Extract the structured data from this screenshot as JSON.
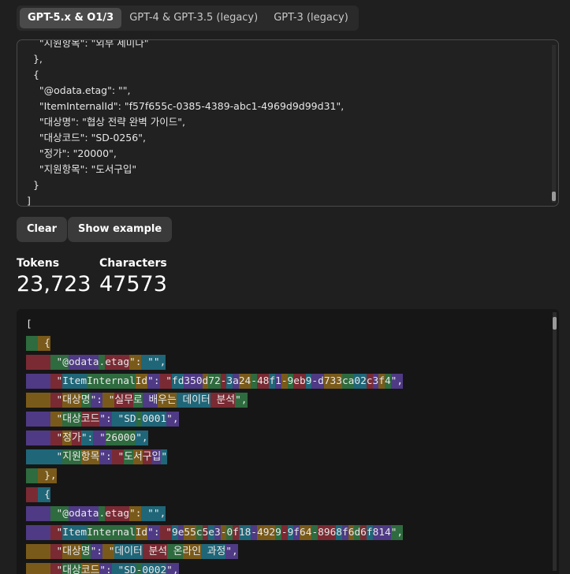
{
  "tabs": [
    {
      "label": "GPT-5.x & O1/3",
      "active": true
    },
    {
      "label": "GPT-4 & GPT-3.5 (legacy)",
      "active": false
    },
    {
      "label": "GPT-3 (legacy)",
      "active": false
    }
  ],
  "input": {
    "lines": [
      "    \"지원항목\": \"외부 세미나\"",
      "  },",
      "  {",
      "    \"@odata.etag\": \"\",",
      "    \"ItemInternalId\": \"f57f655c-0385-4389-abc1-4969d9d99d31\",",
      "    \"대상명\": \"협상 전략 완벽 가이드\",",
      "    \"대상코드\": \"SD-0256\",",
      "    \"정가\": \"20000\",",
      "    \"지원항목\": \"도서구입\"",
      "  }",
      "]"
    ],
    "scroll_fraction": 1.0
  },
  "buttons": {
    "clear": "Clear",
    "example": "Show example"
  },
  "stats": {
    "tokens_label": "Tokens",
    "tokens_value": "23,723",
    "chars_label": "Characters",
    "chars_value": "47573"
  },
  "token_lines": [
    [
      {
        "t": "[",
        "c": -1
      }
    ],
    [
      {
        "t": "  ",
        "c": 1
      },
      {
        "t": " {",
        "c": 2
      }
    ],
    [
      {
        "t": "    ",
        "c": 3
      },
      {
        "t": " \"@",
        "c": 1
      },
      {
        "t": "odata",
        "c": 0
      },
      {
        "t": ".",
        "c": 1
      },
      {
        "t": "etag",
        "c": 3
      },
      {
        "t": "\":",
        "c": 2
      },
      {
        "t": " \"\",",
        "c": 4
      }
    ],
    [
      {
        "t": "    ",
        "c": 0
      },
      {
        "t": " \"",
        "c": 3
      },
      {
        "t": "Item",
        "c": 4
      },
      {
        "t": "Internal",
        "c": 1
      },
      {
        "t": "Id",
        "c": 2
      },
      {
        "t": "\":",
        "c": 0
      },
      {
        "t": " \"",
        "c": 3
      },
      {
        "t": "fd",
        "c": 4
      },
      {
        "t": "350",
        "c": 0
      },
      {
        "t": "d",
        "c": 2
      },
      {
        "t": "72",
        "c": 1
      },
      {
        "t": "-",
        "c": 3
      },
      {
        "t": "3",
        "c": 4
      },
      {
        "t": "a",
        "c": 0
      },
      {
        "t": "24",
        "c": 2
      },
      {
        "t": "-",
        "c": 1
      },
      {
        "t": "48",
        "c": 3
      },
      {
        "t": "f",
        "c": 4
      },
      {
        "t": "1",
        "c": 0
      },
      {
        "t": "-",
        "c": 2
      },
      {
        "t": "9",
        "c": 1
      },
      {
        "t": "eb",
        "c": 3
      },
      {
        "t": "9",
        "c": 4
      },
      {
        "t": "-d",
        "c": 0
      },
      {
        "t": "733",
        "c": 2
      },
      {
        "t": "ca",
        "c": 1
      },
      {
        "t": "02",
        "c": 4
      },
      {
        "t": "c",
        "c": 3
      },
      {
        "t": "3",
        "c": 0
      },
      {
        "t": "f",
        "c": 2
      },
      {
        "t": "4",
        "c": 1
      },
      {
        "t": "\",",
        "c": 0
      }
    ],
    [
      {
        "t": "    ",
        "c": 2
      },
      {
        "t": " \"",
        "c": 3
      },
      {
        "t": "대상",
        "c": 2
      },
      {
        "t": "명",
        "c": 1
      },
      {
        "t": "\":",
        "c": 0
      },
      {
        "t": " \"",
        "c": 2
      },
      {
        "t": "실무",
        "c": 3
      },
      {
        "t": "로",
        "c": 1
      },
      {
        "t": " 배",
        "c": 0
      },
      {
        "t": "우는",
        "c": 2
      },
      {
        "t": " 데이터",
        "c": 4
      },
      {
        "t": " 분석",
        "c": 3
      },
      {
        "t": "\",",
        "c": 1
      }
    ],
    [
      {
        "t": "    ",
        "c": 0
      },
      {
        "t": " \"",
        "c": 2
      },
      {
        "t": "대상",
        "c": 1
      },
      {
        "t": "코드",
        "c": 3
      },
      {
        "t": "\":",
        "c": 0
      },
      {
        "t": " \"",
        "c": 4
      },
      {
        "t": "SD",
        "c": 4
      },
      {
        "t": "-",
        "c": 1
      },
      {
        "t": "0001",
        "c": 4
      },
      {
        "t": "\",",
        "c": 0
      }
    ],
    [
      {
        "t": "    ",
        "c": 0
      },
      {
        "t": " \"",
        "c": 3
      },
      {
        "t": "정",
        "c": 2
      },
      {
        "t": "가",
        "c": 3
      },
      {
        "t": "\":",
        "c": 4
      },
      {
        "t": " \"",
        "c": 0
      },
      {
        "t": "26000",
        "c": 1
      },
      {
        "t": "\",",
        "c": 4
      }
    ],
    [
      {
        "t": "    ",
        "c": 4
      },
      {
        "t": " \"",
        "c": 4
      },
      {
        "t": "지원",
        "c": 1
      },
      {
        "t": "항목",
        "c": 2
      },
      {
        "t": "\":",
        "c": 0
      },
      {
        "t": " \"",
        "c": 3
      },
      {
        "t": "도",
        "c": 1
      },
      {
        "t": "서",
        "c": 2
      },
      {
        "t": "구",
        "c": 3
      },
      {
        "t": "입",
        "c": 0
      },
      {
        "t": "\"",
        "c": 4
      }
    ],
    [
      {
        "t": "  ",
        "c": 1
      },
      {
        "t": " },",
        "c": 2
      }
    ],
    [
      {
        "t": "  ",
        "c": 3
      },
      {
        "t": " {",
        "c": 4
      }
    ],
    [
      {
        "t": "    ",
        "c": 0
      },
      {
        "t": " \"@",
        "c": 1
      },
      {
        "t": "odata",
        "c": 0
      },
      {
        "t": ".",
        "c": 1
      },
      {
        "t": "etag",
        "c": 3
      },
      {
        "t": "\":",
        "c": 2
      },
      {
        "t": " \"\",",
        "c": 4
      }
    ],
    [
      {
        "t": "    ",
        "c": 0
      },
      {
        "t": " \"",
        "c": 3
      },
      {
        "t": "Item",
        "c": 4
      },
      {
        "t": "Internal",
        "c": 1
      },
      {
        "t": "Id",
        "c": 2
      },
      {
        "t": "\":",
        "c": 0
      },
      {
        "t": " \"",
        "c": 3
      },
      {
        "t": "9",
        "c": 4
      },
      {
        "t": "e",
        "c": 0
      },
      {
        "t": "55",
        "c": 2
      },
      {
        "t": "c",
        "c": 1
      },
      {
        "t": "5",
        "c": 3
      },
      {
        "t": "e",
        "c": 4
      },
      {
        "t": "3",
        "c": 0
      },
      {
        "t": "-",
        "c": 2
      },
      {
        "t": "0",
        "c": 1
      },
      {
        "t": "f",
        "c": 3
      },
      {
        "t": "18",
        "c": 4
      },
      {
        "t": "-",
        "c": 0
      },
      {
        "t": "492",
        "c": 2
      },
      {
        "t": "9",
        "c": 1
      },
      {
        "t": "-",
        "c": 3
      },
      {
        "t": "9",
        "c": 4
      },
      {
        "t": "f",
        "c": 0
      },
      {
        "t": "64",
        "c": 2
      },
      {
        "t": "-",
        "c": 1
      },
      {
        "t": "896",
        "c": 3
      },
      {
        "t": "8",
        "c": 4
      },
      {
        "t": "f",
        "c": 0
      },
      {
        "t": "6",
        "c": 2
      },
      {
        "t": "d",
        "c": 1
      },
      {
        "t": "6",
        "c": 3
      },
      {
        "t": "f",
        "c": 4
      },
      {
        "t": "814",
        "c": 0
      },
      {
        "t": "\",",
        "c": 1
      }
    ],
    [
      {
        "t": "    ",
        "c": 2
      },
      {
        "t": " \"",
        "c": 3
      },
      {
        "t": "대상",
        "c": 2
      },
      {
        "t": "명",
        "c": 1
      },
      {
        "t": "\":",
        "c": 0
      },
      {
        "t": " \"",
        "c": 2
      },
      {
        "t": "데이터",
        "c": 4
      },
      {
        "t": " 분석",
        "c": 3
      },
      {
        "t": " 온",
        "c": 1
      },
      {
        "t": "라인",
        "c": 2
      },
      {
        "t": " 과정",
        "c": 4
      },
      {
        "t": "\",",
        "c": 0
      }
    ],
    [
      {
        "t": "    ",
        "c": 2
      },
      {
        "t": " \"",
        "c": 3
      },
      {
        "t": "대상",
        "c": 1
      },
      {
        "t": "코드",
        "c": 2
      },
      {
        "t": "\":",
        "c": 0
      },
      {
        "t": " \"",
        "c": 4
      },
      {
        "t": "SD",
        "c": 4
      },
      {
        "t": "-",
        "c": 1
      },
      {
        "t": "0002",
        "c": 4
      },
      {
        "t": "\",",
        "c": 0
      }
    ]
  ]
}
